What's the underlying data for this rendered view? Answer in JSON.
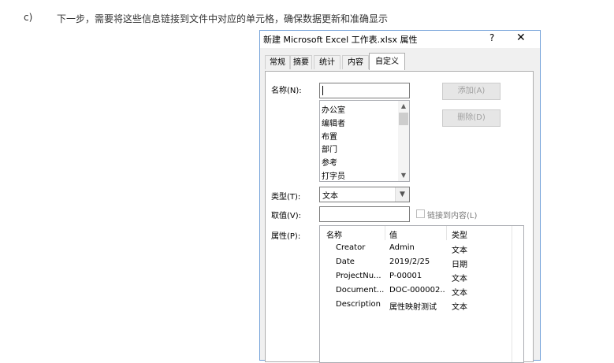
{
  "instruction": {
    "marker": "c)",
    "text": "下一步，需要将这些信息链接到文件中对应的单元格，确保数据更新和准确显示"
  },
  "dialog": {
    "title": "新建 Microsoft Excel 工作表.xlsx 属性",
    "help": "?",
    "close": "✕",
    "tabs": [
      "常规",
      "摘要",
      "统计",
      "内容",
      "自定义"
    ],
    "active_tab": "自定义"
  },
  "form": {
    "name_label": "名称(N):",
    "name_value": "",
    "name_options": [
      "办公室",
      "编辑者",
      "布置",
      "部门",
      "参考",
      "打字员"
    ],
    "add_button": "添加(A)",
    "delete_button": "删除(D)",
    "type_label": "类型(T):",
    "type_value": "文本",
    "value_label": "取值(V):",
    "value_value": "",
    "link_checkbox_label": "链接到内容(L)",
    "link_checked": false,
    "properties_label": "属性(P):"
  },
  "properties_table": {
    "headers": [
      "名称",
      "值",
      "类型"
    ],
    "rows": [
      {
        "name": "Creator",
        "value": "Admin",
        "type": "文本"
      },
      {
        "name": "Date",
        "value": "2019/2/25",
        "type": "日期"
      },
      {
        "name": "ProjectNu...",
        "value": "P-00001",
        "type": "文本"
      },
      {
        "name": "Document...",
        "value": "DOC-000002...",
        "type": "文本"
      },
      {
        "name": "Description",
        "value": "属性映射测试",
        "type": "文本"
      }
    ]
  }
}
